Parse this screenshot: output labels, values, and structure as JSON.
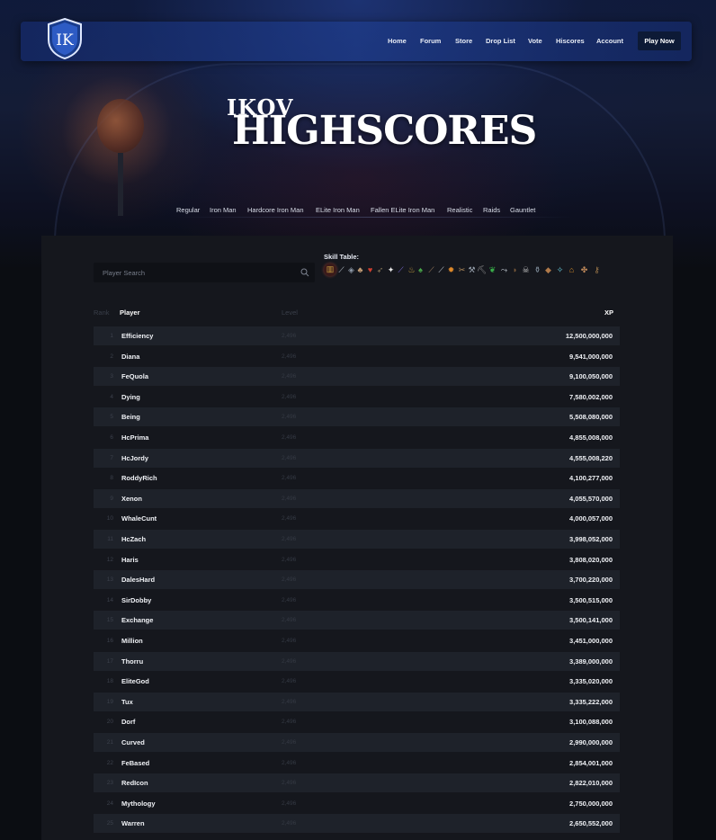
{
  "brand": {
    "logo_text": "IK"
  },
  "nav": {
    "links": [
      "Home",
      "Forum",
      "Store",
      "Drop List",
      "Vote",
      "Hiscores",
      "Account"
    ],
    "cta": "Play Now"
  },
  "hero": {
    "title_small": "IKOV",
    "title_big": "HIGHSCORES"
  },
  "modes": [
    "Regular",
    "Iron Man",
    "Hardcore Iron Man",
    "ELite Iron Man",
    "Fallen ELite Iron Man",
    "Realistic",
    "Raids",
    "Gauntlet"
  ],
  "search": {
    "placeholder": "Player Search",
    "value": ""
  },
  "skills": {
    "label": "Skill Table:",
    "icons": [
      "overall-icon",
      "attack-icon",
      "defence-icon",
      "strength-icon",
      "hitpoints-icon",
      "ranged-icon",
      "prayer-icon",
      "magic-icon",
      "cooking-icon",
      "woodcutting-icon",
      "fletching-icon",
      "fishing-icon",
      "firemaking-icon",
      "crafting-icon",
      "smithing-icon",
      "mining-icon",
      "herblore-icon",
      "agility-icon",
      "thieving-icon",
      "slayer-icon",
      "farming-icon",
      "runecraft-icon",
      "hunter-icon",
      "construction-icon",
      "summoning-icon",
      "dungeoneering-icon"
    ]
  },
  "table": {
    "headers": {
      "rank": "Rank",
      "player": "Player",
      "level": "Level",
      "xp": "XP"
    },
    "rows": [
      {
        "rank": "1",
        "player": "Efficiency",
        "level": "2,496",
        "xp": "12,500,000,000"
      },
      {
        "rank": "2",
        "player": "Diana",
        "level": "2,496",
        "xp": "9,541,000,000"
      },
      {
        "rank": "3",
        "player": "FeQuola",
        "level": "2,496",
        "xp": "9,100,050,000"
      },
      {
        "rank": "4",
        "player": "Dying",
        "level": "2,496",
        "xp": "7,580,002,000"
      },
      {
        "rank": "5",
        "player": "Being",
        "level": "2,496",
        "xp": "5,508,080,000"
      },
      {
        "rank": "6",
        "player": "HcPrima",
        "level": "2,496",
        "xp": "4,855,008,000"
      },
      {
        "rank": "7",
        "player": "HcJordy",
        "level": "2,496",
        "xp": "4,555,008,220"
      },
      {
        "rank": "8",
        "player": "RoddyRich",
        "level": "2,496",
        "xp": "4,100,277,000"
      },
      {
        "rank": "9",
        "player": "Xenon",
        "level": "2,496",
        "xp": "4,055,570,000"
      },
      {
        "rank": "10",
        "player": "WhaleCunt",
        "level": "2,496",
        "xp": "4,000,057,000"
      },
      {
        "rank": "11",
        "player": "HcZach",
        "level": "2,496",
        "xp": "3,998,052,000"
      },
      {
        "rank": "12",
        "player": "Haris",
        "level": "2,496",
        "xp": "3,808,020,000"
      },
      {
        "rank": "13",
        "player": "DalesHard",
        "level": "2,496",
        "xp": "3,700,220,000"
      },
      {
        "rank": "14",
        "player": "SirDobby",
        "level": "2,496",
        "xp": "3,500,515,000"
      },
      {
        "rank": "15",
        "player": "Exchange",
        "level": "2,496",
        "xp": "3,500,141,000"
      },
      {
        "rank": "16",
        "player": "Million",
        "level": "2,496",
        "xp": "3,451,000,000"
      },
      {
        "rank": "17",
        "player": "Thorru",
        "level": "2,496",
        "xp": "3,389,000,000"
      },
      {
        "rank": "18",
        "player": "EliteGod",
        "level": "2,496",
        "xp": "3,335,020,000"
      },
      {
        "rank": "19",
        "player": "Tux",
        "level": "2,496",
        "xp": "3,335,222,000"
      },
      {
        "rank": "20",
        "player": "Dorf",
        "level": "2,496",
        "xp": "3,100,088,000"
      },
      {
        "rank": "21",
        "player": "Curved",
        "level": "2,496",
        "xp": "2,990,000,000"
      },
      {
        "rank": "22",
        "player": "FeBased",
        "level": "2,496",
        "xp": "2,854,001,000"
      },
      {
        "rank": "23",
        "player": "RedIcon",
        "level": "2,496",
        "xp": "2,822,010,000"
      },
      {
        "rank": "24",
        "player": "Mythology",
        "level": "2,496",
        "xp": "2,750,000,000"
      },
      {
        "rank": "25",
        "player": "Warren",
        "level": "2,496",
        "xp": "2,650,552,000"
      }
    ]
  },
  "colors": {
    "accent": "#1e3c8c",
    "row_alt": "#1e222a",
    "panel": "#15171d"
  }
}
